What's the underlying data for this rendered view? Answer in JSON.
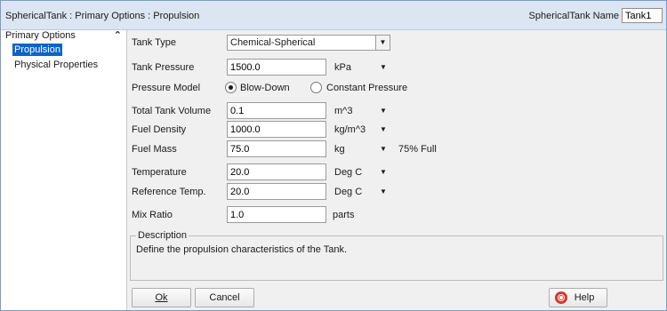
{
  "window": {
    "title": "SphericalTank : Primary Options : Propulsion",
    "name_label": "SphericalTank Name",
    "name_value": "Tank1"
  },
  "sidebar": {
    "header": "Primary Options",
    "collapse_icon": "double-chevron-up-icon",
    "items": [
      {
        "label": "Propulsion",
        "selected": true
      },
      {
        "label": "Physical Properties",
        "selected": false
      }
    ]
  },
  "form": {
    "tank_type": {
      "label": "Tank Type",
      "value": "Chemical-Spherical"
    },
    "tank_pressure": {
      "label": "Tank Pressure",
      "value": "1500.0",
      "unit": "kPa"
    },
    "pressure_model": {
      "label": "Pressure Model",
      "options": [
        {
          "label": "Blow-Down",
          "checked": true
        },
        {
          "label": "Constant Pressure",
          "checked": false
        }
      ]
    },
    "total_tank_volume": {
      "label": "Total Tank Volume",
      "value": "0.1",
      "unit": "m^3"
    },
    "fuel_density": {
      "label": "Fuel Density",
      "value": "1000.0",
      "unit": "kg/m^3"
    },
    "fuel_mass": {
      "label": "Fuel Mass",
      "value": "75.0",
      "unit": "kg",
      "note": "75% Full"
    },
    "temperature": {
      "label": "Temperature",
      "value": "20.0",
      "unit": "Deg C"
    },
    "reference_temp": {
      "label": "Reference Temp.",
      "value": "20.0",
      "unit": "Deg C"
    },
    "mix_ratio": {
      "label": "Mix Ratio",
      "value": "1.0",
      "unit": "parts"
    }
  },
  "description": {
    "title": "Description",
    "text": "Define the propulsion characteristics of the Tank."
  },
  "buttons": {
    "ok": "Ok",
    "cancel": "Cancel",
    "help": "Help",
    "help_icon": "lifebuoy-icon"
  },
  "colors": {
    "selected_bg": "#0a64c8",
    "title_bar": "#dce6f2",
    "help_icon": "#d23a2b"
  }
}
